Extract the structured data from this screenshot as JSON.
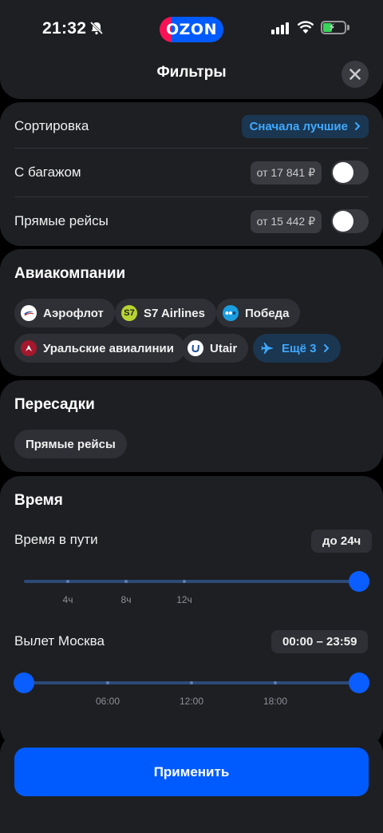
{
  "status_bar": {
    "time": "21:32",
    "logo_text": "OZON"
  },
  "header": {
    "title": "Фильтры"
  },
  "sorting": {
    "label": "Сортировка",
    "value": "Сначала лучшие",
    "baggage_label": "С багажом",
    "baggage_price": "от 17 841 ₽",
    "baggage_on": false,
    "direct_label": "Прямые рейсы",
    "direct_price": "от 15 442 ₽",
    "direct_on": false
  },
  "airlines": {
    "title": "Авиакомпании",
    "items": [
      {
        "label": "Аэрофлот",
        "icon": "aeroflot-icon"
      },
      {
        "label": "S7 Airlines",
        "icon": "s7-icon",
        "icon_text": "S7"
      },
      {
        "label": "Победа",
        "icon": "pobeda-icon"
      },
      {
        "label": "Уральские авиалинии",
        "icon": "ural-airlines-icon"
      },
      {
        "label": "Utair",
        "icon": "utair-icon"
      }
    ],
    "more_label": "Ещё 3"
  },
  "transfers": {
    "title": "Пересадки",
    "chip": "Прямые рейсы"
  },
  "time": {
    "title": "Время",
    "travel_time_label": "Время в пути",
    "travel_time_value": "до 24ч",
    "travel_ticks": [
      "4ч",
      "8ч",
      "12ч"
    ],
    "travel_slider_value": 1.0,
    "departure_label": "Вылет Москва",
    "departure_value": "00:00 – 23:59",
    "departure_ticks": [
      "06:00",
      "12:00",
      "18:00"
    ],
    "departure_range": [
      0.0,
      1.0
    ]
  },
  "footer": {
    "apply_label": "Применить"
  },
  "colors": {
    "accent": "#005bff",
    "link": "#3fa9ff",
    "card": "#1e1f23",
    "background": "#000000"
  }
}
